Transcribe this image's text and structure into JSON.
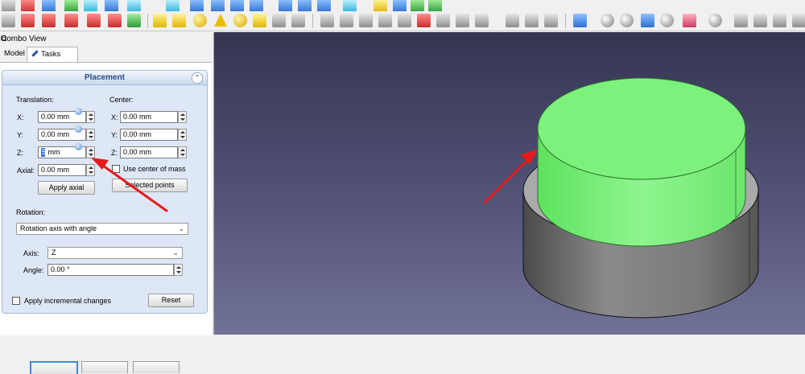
{
  "combo_view": {
    "title": "Combo View",
    "float_glyph": "⧉",
    "tabs": [
      {
        "label": "Model"
      },
      {
        "label": "Tasks",
        "icon": "pencil-icon"
      }
    ]
  },
  "placement": {
    "title": "Placement",
    "collapse_glyph": "⌃",
    "translation": {
      "label": "Translation:",
      "x_label": "X:",
      "x_value": "0.00 mm",
      "y_label": "Y:",
      "y_value": "0.00 mm",
      "z_label": "Z:",
      "z_selected": "5",
      "z_rest": " mm"
    },
    "center": {
      "label": "Center:",
      "x_label": "X:",
      "x_value": "0.00 mm",
      "y_label": "Y:",
      "y_value": "0.00 mm",
      "z_label": "Z:",
      "z_value": "0.00 mm"
    },
    "axial_label": "Axial:",
    "axial_value": "0.00 mm",
    "apply_axial": "Apply axial",
    "use_center_of_mass": "Use center of mass",
    "selected_points": "Selected points",
    "rotation_label": "Rotation:",
    "rotation_mode": "Rotation axis with angle",
    "axis_label": "Axis:",
    "axis_value": "Z",
    "angle_label": "Angle:",
    "angle_value": "0.00 °",
    "apply_incremental": "Apply incremental changes",
    "reset": "Reset"
  },
  "colors": {
    "selection_green": "#7cf27c",
    "arrow_red": "#e8191c",
    "panel_blue": "#dde7f6"
  }
}
